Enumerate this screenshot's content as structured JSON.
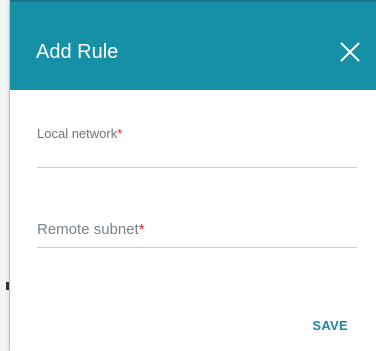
{
  "dialog": {
    "title": "Add Rule",
    "close_icon": "close-icon",
    "save_label": "SAVE"
  },
  "fields": {
    "local_network": {
      "label": "Local network",
      "required_mark": "*",
      "value": ""
    },
    "remote_subnet": {
      "label": "Remote subnet",
      "required_mark": "*",
      "value": ""
    }
  },
  "colors": {
    "header": "#1590a6",
    "accent": "#1a8aa6",
    "required": "#d12d2d"
  }
}
